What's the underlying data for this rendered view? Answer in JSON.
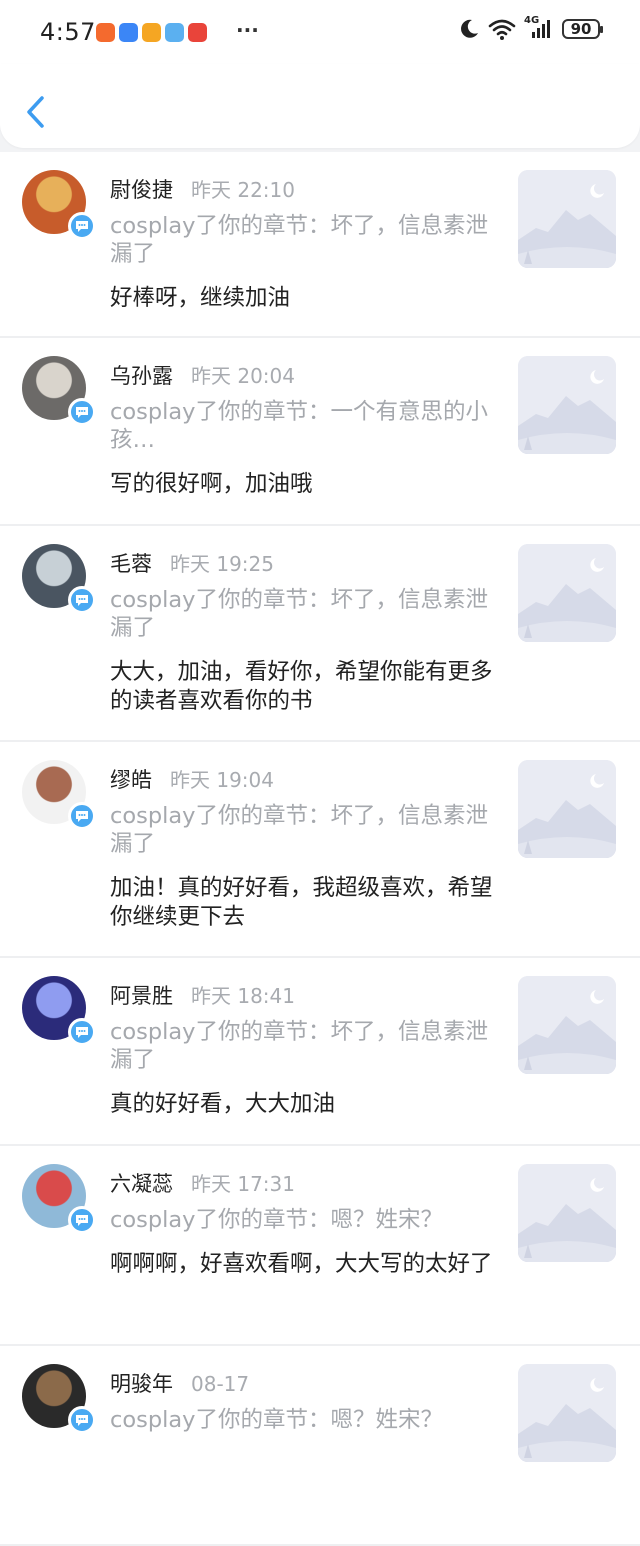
{
  "status_bar": {
    "time": "4:57",
    "app_icons": [
      {
        "name": "app-icon-orange",
        "color": "#f46a2e"
      },
      {
        "name": "app-icon-blue",
        "color": "#3b86f6"
      },
      {
        "name": "app-icon-yellow",
        "color": "#f5a623"
      },
      {
        "name": "app-icon-weather",
        "color": "#5bb0f0"
      },
      {
        "name": "app-icon-red",
        "color": "#e9443a"
      }
    ],
    "more": "···",
    "network": "4G",
    "battery": "90"
  },
  "header": {
    "back_icon": "chevron-left-icon",
    "accent_color": "#3d9cf0"
  },
  "notifications": [
    {
      "name": "尉俊捷",
      "time": "昨天 22:10",
      "source": "cosplay了你的章节：坏了，信息素泄漏了",
      "comment": "好棒呀，继续加油",
      "avatar_colors": [
        "#c75c2b",
        "#e7b05a"
      ]
    },
    {
      "name": "乌孙露",
      "time": "昨天 20:04",
      "source": "cosplay了你的章节：一个有意思的小孩…",
      "comment": "写的很好啊，加油哦",
      "avatar_colors": [
        "#6c6a68",
        "#d9d4cc"
      ]
    },
    {
      "name": "毛蓉",
      "time": "昨天 19:25",
      "source": "cosplay了你的章节：坏了，信息素泄漏了",
      "comment": "大大，加油，看好你，希望你能有更多的读者喜欢看你的书",
      "avatar_colors": [
        "#4a5561",
        "#c7d0d6"
      ]
    },
    {
      "name": "缪皓",
      "time": "昨天 19:04",
      "source": "cosplay了你的章节：坏了，信息素泄漏了",
      "comment": "加油！真的好好看，我超级喜欢，希望你继续更下去",
      "avatar_colors": [
        "#f2f2f2",
        "#a86a52"
      ]
    },
    {
      "name": "阿景胜",
      "time": "昨天 18:41",
      "source": "cosplay了你的章节：坏了，信息素泄漏了",
      "comment": "真的好好看，大大加油",
      "avatar_colors": [
        "#2b2b7a",
        "#8f9cf0"
      ]
    },
    {
      "name": "六凝蕊",
      "time": "昨天 17:31",
      "source": "cosplay了你的章节：嗯？姓宋？",
      "comment": "啊啊啊，好喜欢看啊，大大写的太好了",
      "avatar_colors": [
        "#8fb9d8",
        "#d94b4b"
      ]
    },
    {
      "name": "明骏年",
      "time": "08-17",
      "source": "cosplay了你的章节：嗯？姓宋？",
      "comment": "",
      "avatar_colors": [
        "#2a2a2a",
        "#8b6a4a"
      ]
    }
  ]
}
